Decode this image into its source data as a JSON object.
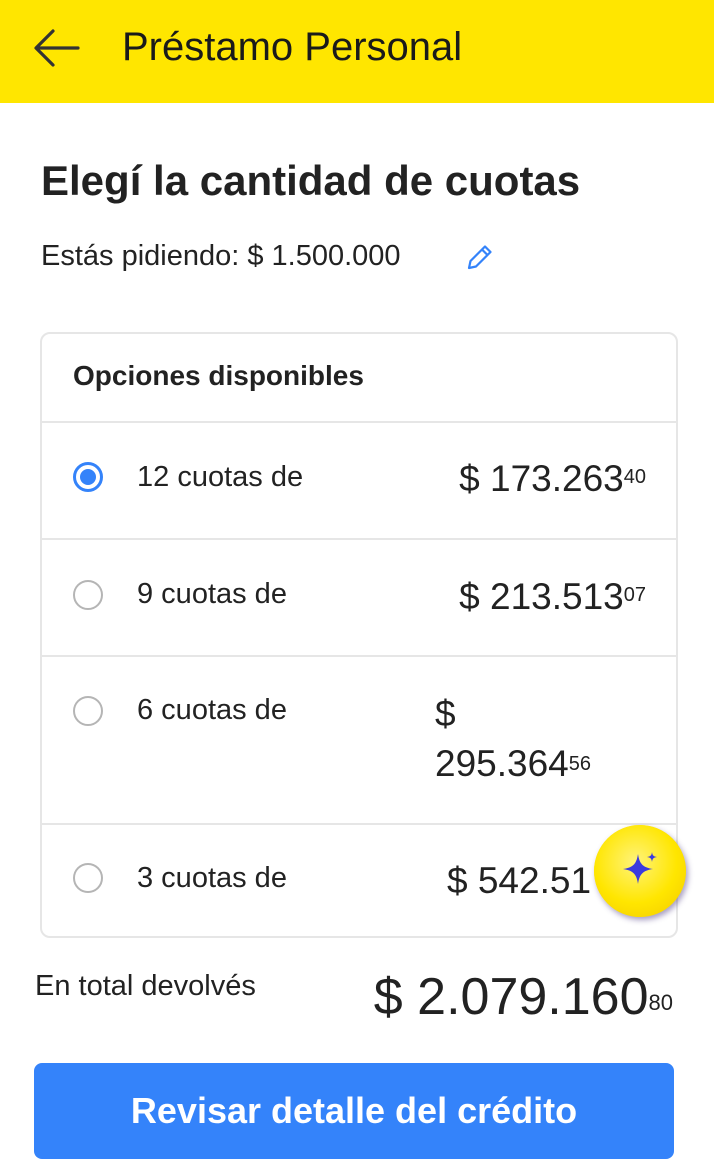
{
  "header": {
    "title": "Préstamo Personal",
    "back_icon": "arrow-left-icon",
    "background": "#ffe600"
  },
  "main": {
    "title": "Elegí la cantidad de cuotas",
    "amount_text": "Estás pidiendo: $ 1.500.000",
    "edit_icon": "pencil-icon"
  },
  "options": {
    "heading": "Opciones disponibles",
    "items": [
      {
        "label": "12 cuotas de",
        "currency": "$",
        "amount": "173.263",
        "cents": "40",
        "selected": true
      },
      {
        "label": "9 cuotas de",
        "currency": "$",
        "amount": "213.513",
        "cents": "07",
        "selected": false
      },
      {
        "label": "6 cuotas de",
        "currency": "$",
        "amount": "295.364",
        "cents": "56",
        "selected": false
      },
      {
        "label": "3 cuotas de",
        "currency": "$",
        "amount": "542.51",
        "cents": "",
        "selected": false
      }
    ]
  },
  "total": {
    "label": "En total devolvés",
    "currency": "$",
    "amount": "2.079.160",
    "cents": "80"
  },
  "cta": {
    "label": "Revisar detalle del crédito",
    "color": "#3483fa"
  },
  "fab": {
    "icon": "sparkle-icon"
  }
}
